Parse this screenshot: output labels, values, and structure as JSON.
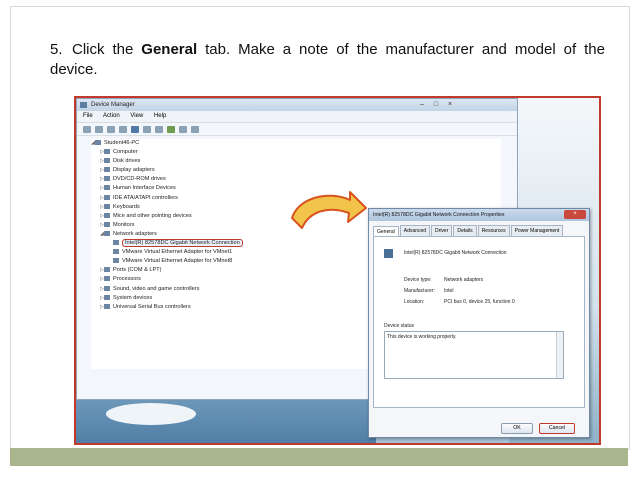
{
  "instruction": {
    "number": "5.",
    "pre": "Click the ",
    "bold": "General",
    "post": " tab. Make a note of the manufacturer and model of the device."
  },
  "device_manager": {
    "title": "Device Manager",
    "window_controls": [
      "–",
      "□",
      "×"
    ],
    "menu": [
      "File",
      "Action",
      "View",
      "Help"
    ],
    "tree": [
      {
        "label": "Student46-PC",
        "level": 0,
        "expanded": true,
        "icon": "computer-icon"
      },
      {
        "label": "Computer",
        "level": 1,
        "icon": "computer-icon"
      },
      {
        "label": "Disk drives",
        "level": 1,
        "icon": "disk-icon"
      },
      {
        "label": "Display adapters",
        "level": 1,
        "icon": "display-icon"
      },
      {
        "label": "DVD/CD-ROM drives",
        "level": 1,
        "icon": "dvd-icon"
      },
      {
        "label": "Human Interface Devices",
        "level": 1,
        "icon": "hid-icon"
      },
      {
        "label": "IDE ATA/ATAPI controllers",
        "level": 1,
        "icon": "ide-icon"
      },
      {
        "label": "Keyboards",
        "level": 1,
        "icon": "keyboard-icon"
      },
      {
        "label": "Mice and other pointing devices",
        "level": 1,
        "icon": "mouse-icon"
      },
      {
        "label": "Monitors",
        "level": 1,
        "icon": "monitor-icon"
      },
      {
        "label": "Network adapters",
        "level": 1,
        "expanded": true,
        "icon": "network-icon"
      },
      {
        "label": "Intel(R) 82578DC Gigabit Network Connection",
        "level": 2,
        "icon": "network-icon",
        "highlighted": true
      },
      {
        "label": "VMware Virtual Ethernet Adapter for VMnet1",
        "level": 2,
        "icon": "network-icon"
      },
      {
        "label": "VMware Virtual Ethernet Adapter for VMnet8",
        "level": 2,
        "icon": "network-icon"
      },
      {
        "label": "Ports (COM & LPT)",
        "level": 1,
        "icon": "port-icon"
      },
      {
        "label": "Processors",
        "level": 1,
        "icon": "cpu-icon"
      },
      {
        "label": "Sound, video and game controllers",
        "level": 1,
        "icon": "sound-icon"
      },
      {
        "label": "System devices",
        "level": 1,
        "icon": "system-icon"
      },
      {
        "label": "Universal Serial Bus controllers",
        "level": 1,
        "icon": "usb-icon"
      }
    ]
  },
  "properties_dialog": {
    "title": "Intel(R) 82578DC Gigabit Network Connection Properties",
    "close": "×",
    "tabs": [
      "General",
      "Advanced",
      "Driver",
      "Details",
      "Resources",
      "Power Management"
    ],
    "active_tab": "General",
    "device_name": "Intel(R) 82578DC Gigabit Network Connection",
    "fields": [
      {
        "key": "Device type:",
        "value": "Network adapters"
      },
      {
        "key": "Manufacturer:",
        "value": "Intel"
      },
      {
        "key": "Location:",
        "value": "PCI bus 0, device 25, function 0"
      }
    ],
    "status_label": "Device status",
    "status_text": "This device is working properly.",
    "ok_label": "OK",
    "cancel_label": "Cancel"
  },
  "colors": {
    "highlight": "#c0392b",
    "arrow_fill": "#f2c44a",
    "arrow_stroke": "#d9531e",
    "footer": "#a9b58c"
  }
}
